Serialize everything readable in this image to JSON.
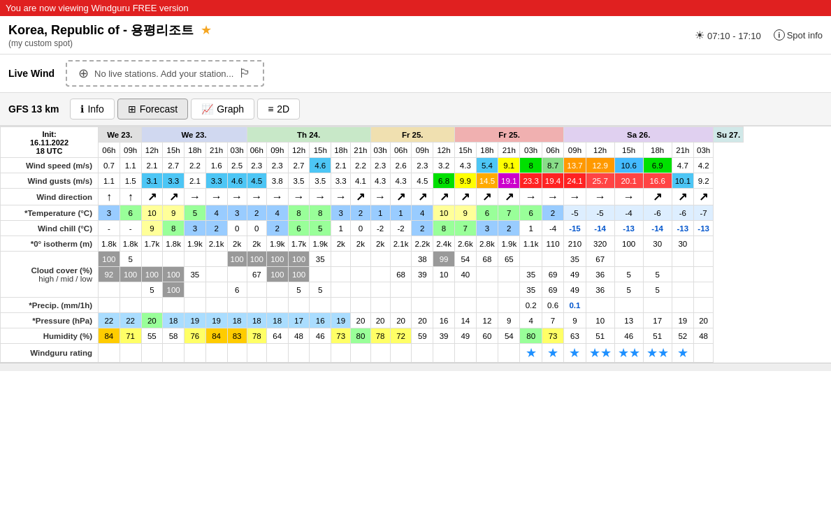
{
  "banner": {
    "text": "You are now viewing Windguru FREE version"
  },
  "header": {
    "title": "Korea, Republic of - 용평리조트",
    "subtitle": "(my custom spot)",
    "suntime": "07:10 - 17:10",
    "spot_info": "Spot info"
  },
  "live_wind": {
    "label": "Live Wind",
    "placeholder": "No live stations. Add your station..."
  },
  "tabs_bar": {
    "model_label": "GFS 13 km",
    "tabs": [
      {
        "id": "info",
        "label": "Info",
        "icon": "ℹ"
      },
      {
        "id": "forecast",
        "label": "Forecast",
        "icon": "⊞"
      },
      {
        "id": "graph",
        "label": "Graph",
        "icon": "📈"
      },
      {
        "id": "2d",
        "label": "2D",
        "icon": "≡"
      }
    ]
  },
  "table": {
    "init_label": "Init:",
    "init_date": "16.11.2022",
    "init_utc": "18 UTC",
    "rows": {
      "wind_speed": "Wind speed (m/s)",
      "wind_gusts": "Wind gusts (m/s)",
      "wind_direction": "Wind direction",
      "temperature": "*Temperature (°C)",
      "wind_chill": "Wind chill (°C)",
      "isotherm": "*0° isotherm (m)",
      "cloud_cover": "Cloud cover (%)",
      "cloud_hl": "high / mid / low",
      "precip": "*Precip. (mm/1h)",
      "pressure": "*Pressure (hPa)",
      "humidity": "Humidity (%)",
      "rating": "Windguru rating"
    }
  }
}
